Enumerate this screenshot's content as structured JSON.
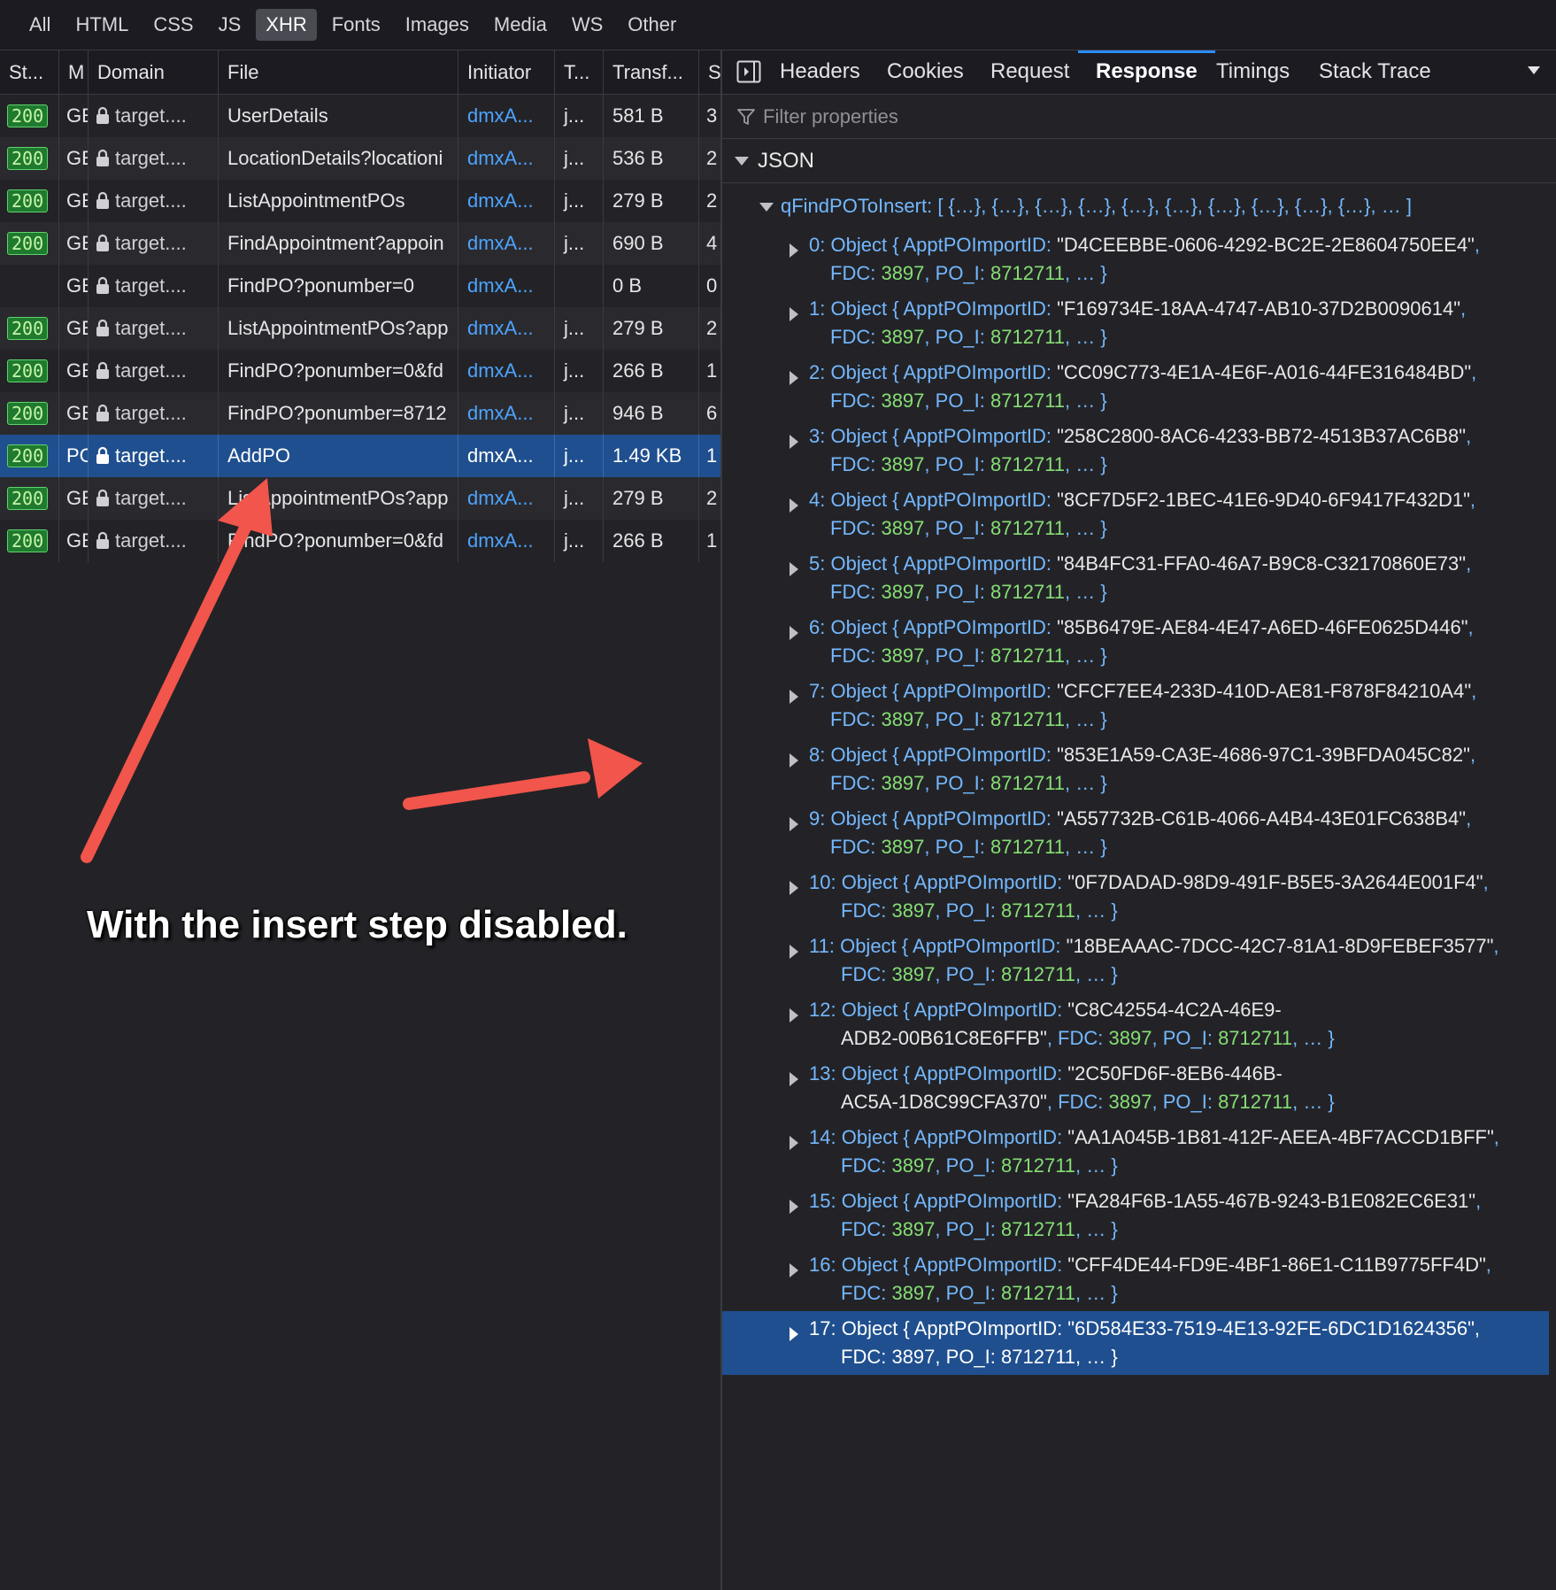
{
  "filter_tabs": [
    "All",
    "HTML",
    "CSS",
    "JS",
    "XHR",
    "Fonts",
    "Images",
    "Media",
    "WS",
    "Other"
  ],
  "active_filter": "XHR",
  "columns": {
    "status": "St...",
    "method": "M",
    "domain": "Domain",
    "file": "File",
    "initiator": "Initiator",
    "type": "T...",
    "transferred": "Transf...",
    "size": "S"
  },
  "requests": [
    {
      "status": "200",
      "method": "GE",
      "domain": "target....",
      "file": "UserDetails",
      "initiator": "dmxA...",
      "type": "j...",
      "transferred": "581 B",
      "size": "3"
    },
    {
      "status": "200",
      "method": "GE",
      "domain": "target....",
      "file": "LocationDetails?locationi",
      "initiator": "dmxA...",
      "type": "j...",
      "transferred": "536 B",
      "size": "2"
    },
    {
      "status": "200",
      "method": "GE",
      "domain": "target....",
      "file": "ListAppointmentPOs",
      "initiator": "dmxA...",
      "type": "j...",
      "transferred": "279 B",
      "size": "2"
    },
    {
      "status": "200",
      "method": "GE",
      "domain": "target....",
      "file": "FindAppointment?appoin",
      "initiator": "dmxA...",
      "type": "j...",
      "transferred": "690 B",
      "size": "4"
    },
    {
      "status": "",
      "method": "GE",
      "domain": "target....",
      "file": "FindPO?ponumber=0",
      "initiator": "dmxA...",
      "type": "",
      "transferred": "0 B",
      "size": "0"
    },
    {
      "status": "200",
      "method": "GE",
      "domain": "target....",
      "file": "ListAppointmentPOs?app",
      "initiator": "dmxA...",
      "type": "j...",
      "transferred": "279 B",
      "size": "2"
    },
    {
      "status": "200",
      "method": "GE",
      "domain": "target....",
      "file": "FindPO?ponumber=0&fd",
      "initiator": "dmxA...",
      "type": "j...",
      "transferred": "266 B",
      "size": "1"
    },
    {
      "status": "200",
      "method": "GE",
      "domain": "target....",
      "file": "FindPO?ponumber=8712",
      "initiator": "dmxA...",
      "type": "j...",
      "transferred": "946 B",
      "size": "6"
    },
    {
      "status": "200",
      "method": "PC",
      "domain": "target....",
      "file": "AddPO",
      "initiator": "dmxA...",
      "type": "j...",
      "transferred": "1.49 KB",
      "size": "1",
      "selected": true
    },
    {
      "status": "200",
      "method": "GE",
      "domain": "target....",
      "file": "ListAppointmentPOs?app",
      "initiator": "dmxA...",
      "type": "j...",
      "transferred": "279 B",
      "size": "2"
    },
    {
      "status": "200",
      "method": "GE",
      "domain": "target....",
      "file": "FindPO?ponumber=0&fd",
      "initiator": "dmxA...",
      "type": "j...",
      "transferred": "266 B",
      "size": "1"
    }
  ],
  "detail_tabs": [
    "Headers",
    "Cookies",
    "Request",
    "Response",
    "Timings",
    "Stack Trace"
  ],
  "active_detail_tab": "Response",
  "filter_properties_placeholder": "Filter properties",
  "json_label": "JSON",
  "root_key": "qFindPOToInsert:",
  "root_preview": "[ {…}, {…}, {…}, {…}, {…}, {…}, {…}, {…}, {…}, {…}, … ]",
  "items": [
    {
      "idx": "0",
      "id": "D4CEEBBE-0606-4292-BC2E-2E8604750EE4"
    },
    {
      "idx": "1",
      "id": "F169734E-18AA-4747-AB10-37D2B0090614"
    },
    {
      "idx": "2",
      "id": "CC09C773-4E1A-4E6F-A016-44FE316484BD"
    },
    {
      "idx": "3",
      "id": "258C2800-8AC6-4233-BB72-4513B37AC6B8"
    },
    {
      "idx": "4",
      "id": "8CF7D5F2-1BEC-41E6-9D40-6F9417F432D1"
    },
    {
      "idx": "5",
      "id": "84B4FC31-FFA0-46A7-B9C8-C32170860E73"
    },
    {
      "idx": "6",
      "id": "85B6479E-AE84-4E47-A6ED-46FE0625D446"
    },
    {
      "idx": "7",
      "id": "CFCF7EE4-233D-410D-AE81-F878F84210A4"
    },
    {
      "idx": "8",
      "id": "853E1A59-CA3E-4686-97C1-39BFDA045C82"
    },
    {
      "idx": "9",
      "id": "A557732B-C61B-4066-A4B4-43E01FC638B4"
    },
    {
      "idx": "10",
      "id": "0F7DADAD-98D9-491F-B5E5-3A2644E001F4"
    },
    {
      "idx": "11",
      "id": "18BEAAAC-7DCC-42C7-81A1-8D9FEBEF3577"
    },
    {
      "idx": "12",
      "id": "C8C42554-4C2A-46E9-ADB2-00B61C8E6FFB",
      "wrap": true
    },
    {
      "idx": "13",
      "id": "2C50FD6F-8EB6-446B-AC5A-1D8C99CFA370",
      "wrap": true
    },
    {
      "idx": "14",
      "id": "AA1A045B-1B81-412F-AEEA-4BF7ACCD1BFF"
    },
    {
      "idx": "15",
      "id": "FA284F6B-1A55-467B-9243-B1E082EC6E31"
    },
    {
      "idx": "16",
      "id": "CFF4DE44-FD9E-4BF1-86E1-C11B9775FF4D"
    },
    {
      "idx": "17",
      "id": "6D584E33-7519-4E13-92FE-6DC1D1624356",
      "selected": true
    }
  ],
  "field_labels": {
    "object": "Object",
    "id_key": "ApptPOImportID",
    "fdc_key": "FDC",
    "po_key": "PO_I"
  },
  "field_values": {
    "fdc": "3897",
    "po": "8712711"
  },
  "annotation": "With the insert step disabled."
}
